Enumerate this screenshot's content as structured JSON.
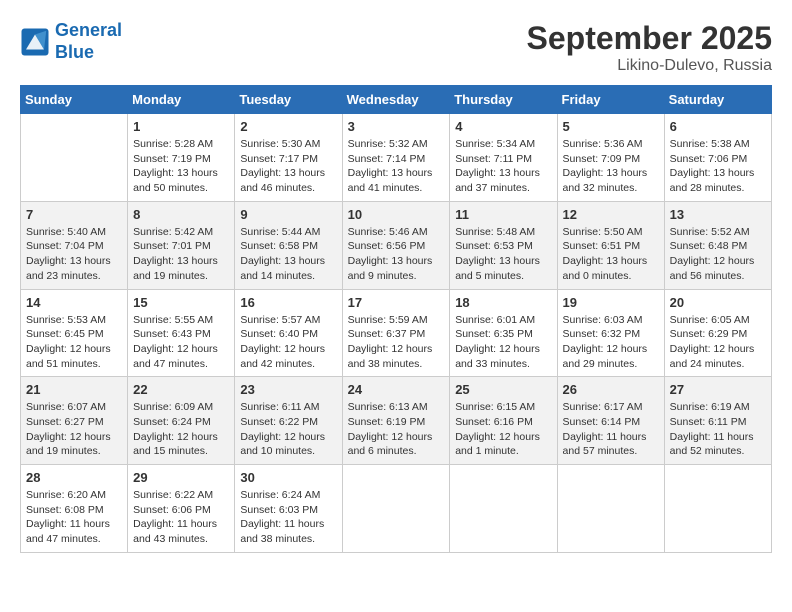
{
  "header": {
    "logo_line1": "General",
    "logo_line2": "Blue",
    "month": "September 2025",
    "location": "Likino-Dulevo, Russia"
  },
  "days_of_week": [
    "Sunday",
    "Monday",
    "Tuesday",
    "Wednesday",
    "Thursday",
    "Friday",
    "Saturday"
  ],
  "weeks": [
    [
      {
        "day": "",
        "info": ""
      },
      {
        "day": "1",
        "info": "Sunrise: 5:28 AM\nSunset: 7:19 PM\nDaylight: 13 hours\nand 50 minutes."
      },
      {
        "day": "2",
        "info": "Sunrise: 5:30 AM\nSunset: 7:17 PM\nDaylight: 13 hours\nand 46 minutes."
      },
      {
        "day": "3",
        "info": "Sunrise: 5:32 AM\nSunset: 7:14 PM\nDaylight: 13 hours\nand 41 minutes."
      },
      {
        "day": "4",
        "info": "Sunrise: 5:34 AM\nSunset: 7:11 PM\nDaylight: 13 hours\nand 37 minutes."
      },
      {
        "day": "5",
        "info": "Sunrise: 5:36 AM\nSunset: 7:09 PM\nDaylight: 13 hours\nand 32 minutes."
      },
      {
        "day": "6",
        "info": "Sunrise: 5:38 AM\nSunset: 7:06 PM\nDaylight: 13 hours\nand 28 minutes."
      }
    ],
    [
      {
        "day": "7",
        "info": "Sunrise: 5:40 AM\nSunset: 7:04 PM\nDaylight: 13 hours\nand 23 minutes."
      },
      {
        "day": "8",
        "info": "Sunrise: 5:42 AM\nSunset: 7:01 PM\nDaylight: 13 hours\nand 19 minutes."
      },
      {
        "day": "9",
        "info": "Sunrise: 5:44 AM\nSunset: 6:58 PM\nDaylight: 13 hours\nand 14 minutes."
      },
      {
        "day": "10",
        "info": "Sunrise: 5:46 AM\nSunset: 6:56 PM\nDaylight: 13 hours\nand 9 minutes."
      },
      {
        "day": "11",
        "info": "Sunrise: 5:48 AM\nSunset: 6:53 PM\nDaylight: 13 hours\nand 5 minutes."
      },
      {
        "day": "12",
        "info": "Sunrise: 5:50 AM\nSunset: 6:51 PM\nDaylight: 13 hours\nand 0 minutes."
      },
      {
        "day": "13",
        "info": "Sunrise: 5:52 AM\nSunset: 6:48 PM\nDaylight: 12 hours\nand 56 minutes."
      }
    ],
    [
      {
        "day": "14",
        "info": "Sunrise: 5:53 AM\nSunset: 6:45 PM\nDaylight: 12 hours\nand 51 minutes."
      },
      {
        "day": "15",
        "info": "Sunrise: 5:55 AM\nSunset: 6:43 PM\nDaylight: 12 hours\nand 47 minutes."
      },
      {
        "day": "16",
        "info": "Sunrise: 5:57 AM\nSunset: 6:40 PM\nDaylight: 12 hours\nand 42 minutes."
      },
      {
        "day": "17",
        "info": "Sunrise: 5:59 AM\nSunset: 6:37 PM\nDaylight: 12 hours\nand 38 minutes."
      },
      {
        "day": "18",
        "info": "Sunrise: 6:01 AM\nSunset: 6:35 PM\nDaylight: 12 hours\nand 33 minutes."
      },
      {
        "day": "19",
        "info": "Sunrise: 6:03 AM\nSunset: 6:32 PM\nDaylight: 12 hours\nand 29 minutes."
      },
      {
        "day": "20",
        "info": "Sunrise: 6:05 AM\nSunset: 6:29 PM\nDaylight: 12 hours\nand 24 minutes."
      }
    ],
    [
      {
        "day": "21",
        "info": "Sunrise: 6:07 AM\nSunset: 6:27 PM\nDaylight: 12 hours\nand 19 minutes."
      },
      {
        "day": "22",
        "info": "Sunrise: 6:09 AM\nSunset: 6:24 PM\nDaylight: 12 hours\nand 15 minutes."
      },
      {
        "day": "23",
        "info": "Sunrise: 6:11 AM\nSunset: 6:22 PM\nDaylight: 12 hours\nand 10 minutes."
      },
      {
        "day": "24",
        "info": "Sunrise: 6:13 AM\nSunset: 6:19 PM\nDaylight: 12 hours\nand 6 minutes."
      },
      {
        "day": "25",
        "info": "Sunrise: 6:15 AM\nSunset: 6:16 PM\nDaylight: 12 hours\nand 1 minute."
      },
      {
        "day": "26",
        "info": "Sunrise: 6:17 AM\nSunset: 6:14 PM\nDaylight: 11 hours\nand 57 minutes."
      },
      {
        "day": "27",
        "info": "Sunrise: 6:19 AM\nSunset: 6:11 PM\nDaylight: 11 hours\nand 52 minutes."
      }
    ],
    [
      {
        "day": "28",
        "info": "Sunrise: 6:20 AM\nSunset: 6:08 PM\nDaylight: 11 hours\nand 47 minutes."
      },
      {
        "day": "29",
        "info": "Sunrise: 6:22 AM\nSunset: 6:06 PM\nDaylight: 11 hours\nand 43 minutes."
      },
      {
        "day": "30",
        "info": "Sunrise: 6:24 AM\nSunset: 6:03 PM\nDaylight: 11 hours\nand 38 minutes."
      },
      {
        "day": "",
        "info": ""
      },
      {
        "day": "",
        "info": ""
      },
      {
        "day": "",
        "info": ""
      },
      {
        "day": "",
        "info": ""
      }
    ]
  ]
}
